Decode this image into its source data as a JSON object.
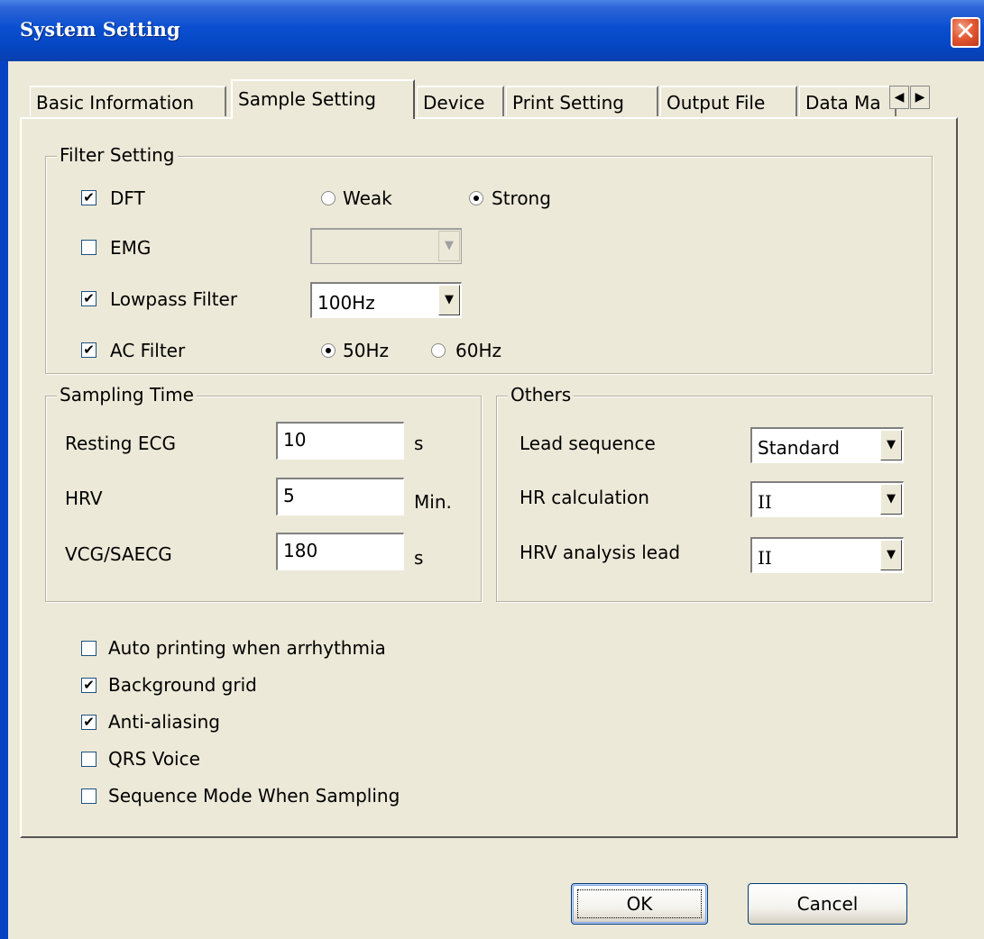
{
  "window": {
    "title": "System Setting",
    "close_glyph": "✕"
  },
  "tabs": [
    {
      "label": "Basic Information"
    },
    {
      "label": "Sample Setting",
      "active": true
    },
    {
      "label": "Device"
    },
    {
      "label": "Print Setting"
    },
    {
      "label": "Output File"
    },
    {
      "label": "Data Ma"
    }
  ],
  "tab_scroll": {
    "left_icon": "◀",
    "right_icon": "▶"
  },
  "filter_setting": {
    "legend": "Filter Setting",
    "dft": {
      "label": "DFT",
      "checked": true
    },
    "dft_strength": {
      "weak_label": "Weak",
      "strong_label": "Strong",
      "selected": "Strong"
    },
    "emg": {
      "label": "EMG",
      "checked": false,
      "value": "",
      "enabled": false
    },
    "lowpass": {
      "label": "Lowpass Filter",
      "checked": true,
      "value": "100Hz"
    },
    "ac_filter": {
      "label": "AC Filter",
      "checked": true
    },
    "ac_frequency": {
      "label_50": "50Hz",
      "label_60": "60Hz",
      "selected": "50Hz"
    }
  },
  "sampling_time": {
    "legend": "Sampling Time",
    "resting_ecg": {
      "label": "Resting ECG",
      "value": "10",
      "unit": "s"
    },
    "hrv": {
      "label": "HRV",
      "value": "5",
      "unit": "Min."
    },
    "vcg_saecg": {
      "label": "VCG/SAECG",
      "value": "180",
      "unit": "s"
    }
  },
  "others": {
    "legend": "Others",
    "lead_sequence": {
      "label": "Lead sequence",
      "value": "Standard"
    },
    "hr_calculation": {
      "label": "HR calculation",
      "value": "II"
    },
    "hrv_analysis_lead": {
      "label": "HRV analysis lead",
      "value": "II"
    }
  },
  "options": [
    {
      "label": "Auto printing when arrhythmia",
      "checked": false
    },
    {
      "label": "Background grid",
      "checked": true
    },
    {
      "label": "Anti-aliasing",
      "checked": true
    },
    {
      "label": "QRS Voice",
      "checked": false
    },
    {
      "label": "Sequence Mode When Sampling",
      "checked": false
    }
  ],
  "buttons": {
    "ok": "OK",
    "cancel": "Cancel"
  },
  "glyphs": {
    "check": "✔",
    "dropdown": "▼"
  },
  "colors": {
    "titlebar": "#0a4fd0",
    "dialog_bg": "#ece9d8",
    "close": "#e35a33"
  }
}
